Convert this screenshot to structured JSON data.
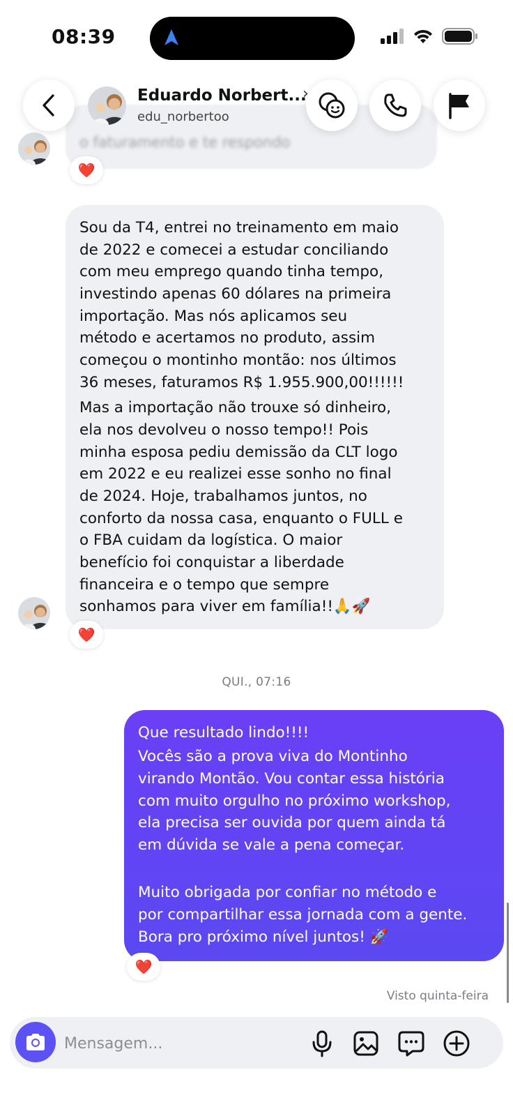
{
  "status_bar": {
    "time": "08:39"
  },
  "header": {
    "name": "Eduardo Norbert...",
    "username": "edu_norbertoo",
    "chevron": "›",
    "icons": [
      "back-icon",
      "sticker-icon",
      "phone-icon",
      "flag-icon"
    ]
  },
  "previous_message": {
    "text": "o faturamento e te respondo",
    "reaction": "❤️"
  },
  "incoming_message": {
    "lines": [
      "Sou da T4, entrei no treinamento em maio",
      "de 2022 e comecei a estudar conciliando",
      "com meu emprego quando tinha tempo,",
      "investindo apenas 60 dólares na primeira",
      "importação. Mas nós aplicamos seu",
      "método e acertamos no produto, assim",
      "começou o montinho montão: nos últimos",
      "36 meses, faturamos R$ 1.955.900,00!!!!!!",
      "Mas a importação não trouxe só dinheiro,",
      "ela nos devolveu o nosso tempo!! Pois",
      "minha esposa pediu demissão da CLT logo",
      "em 2022 e eu realizei esse sonho no final",
      "de 2024. Hoje, trabalhamos juntos, no",
      "conforto da nossa casa, enquanto o FULL e",
      "o FBA cuidam da logística. O maior",
      "benefício foi conquistar a liberdade",
      "financeira e o tempo que sempre",
      "sonhamos para viver em família!!🙏🚀"
    ],
    "reaction": "❤️"
  },
  "timestamp": "QUI., 07:16",
  "outgoing_message": {
    "lines": [
      "Que resultado lindo!!!!",
      "Vocês são a prova viva do Montinho",
      "virando Montão. Vou contar essa história",
      "com muito orgulho no próximo workshop,",
      "ela precisa ser ouvida por quem ainda tá",
      "em dúvida se vale a pena começar.",
      "",
      "Muito obrigada por confiar no método e",
      "por compartilhar essa jornada com a gente.",
      "Bora pro próximo nível juntos! 🚀"
    ],
    "reaction": "❤️"
  },
  "seen_status": "Visto quinta-feira",
  "composer": {
    "placeholder": "Mensagem...",
    "icons": [
      "camera-icon",
      "microphone-icon",
      "image-icon",
      "sticker-bubble-icon",
      "plus-icon"
    ]
  },
  "colors": {
    "outgoing_bubble": "#6a3ff7",
    "incoming_bubble": "#eef0f3",
    "camera_button": "#5b51f5",
    "reaction_heart": "#e0245e"
  }
}
